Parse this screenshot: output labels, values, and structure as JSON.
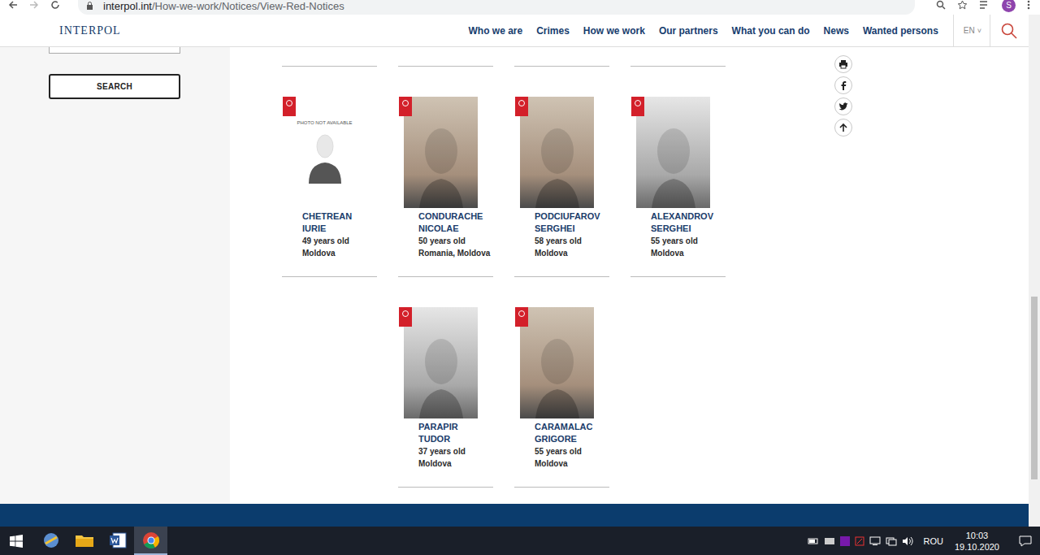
{
  "browser": {
    "url_domain": "interpol.int",
    "url_path": "/How-we-work/Notices/View-Red-Notices",
    "profile": "S"
  },
  "site": {
    "logo": "INTERPOL",
    "nav": [
      "Who we are",
      "Crimes",
      "How we work",
      "Our partners",
      "What you can do",
      "News",
      "Wanted persons"
    ],
    "language": "EN",
    "language_caret": "˅"
  },
  "sidebar": {
    "search_button": "SEARCH"
  },
  "notices": [
    {
      "surname": "CHETREAN",
      "forename": "IURIE",
      "age": "49 years old",
      "nationality": "Moldova",
      "kind": "placeholder",
      "photo_text": "PHOTO NOT AVAILABLE"
    },
    {
      "surname": "CONDURACHE",
      "forename": "NICOLAE",
      "age": "50 years old",
      "nationality": "Romania, Moldova",
      "kind": "color-photo"
    },
    {
      "surname": "PODCIUFAROV",
      "forename": "SERGHEI",
      "age": "58 years old",
      "nationality": "Moldova",
      "kind": "color-photo"
    },
    {
      "surname": "ALEXANDROV",
      "forename": "SERGHEI",
      "age": "55 years old",
      "nationality": "Moldova",
      "kind": "grayscale-photo"
    },
    {
      "surname": "PARAPIR",
      "forename": "TUDOR",
      "age": "37 years old",
      "nationality": "Moldova",
      "kind": "grayscale-photo"
    },
    {
      "surname": "CARAMALAC",
      "forename": "GRIGORE",
      "age": "55 years old",
      "nationality": "Moldova",
      "kind": "color-photo"
    }
  ],
  "taskbar": {
    "apps": [
      {
        "kind": "settings",
        "selected": false
      },
      {
        "kind": "explorer",
        "selected": false
      },
      {
        "kind": "word",
        "selected": false
      },
      {
        "kind": "chrome",
        "selected": true
      }
    ],
    "language": "ROU",
    "time": "10:03",
    "date": "19.10.2020"
  }
}
